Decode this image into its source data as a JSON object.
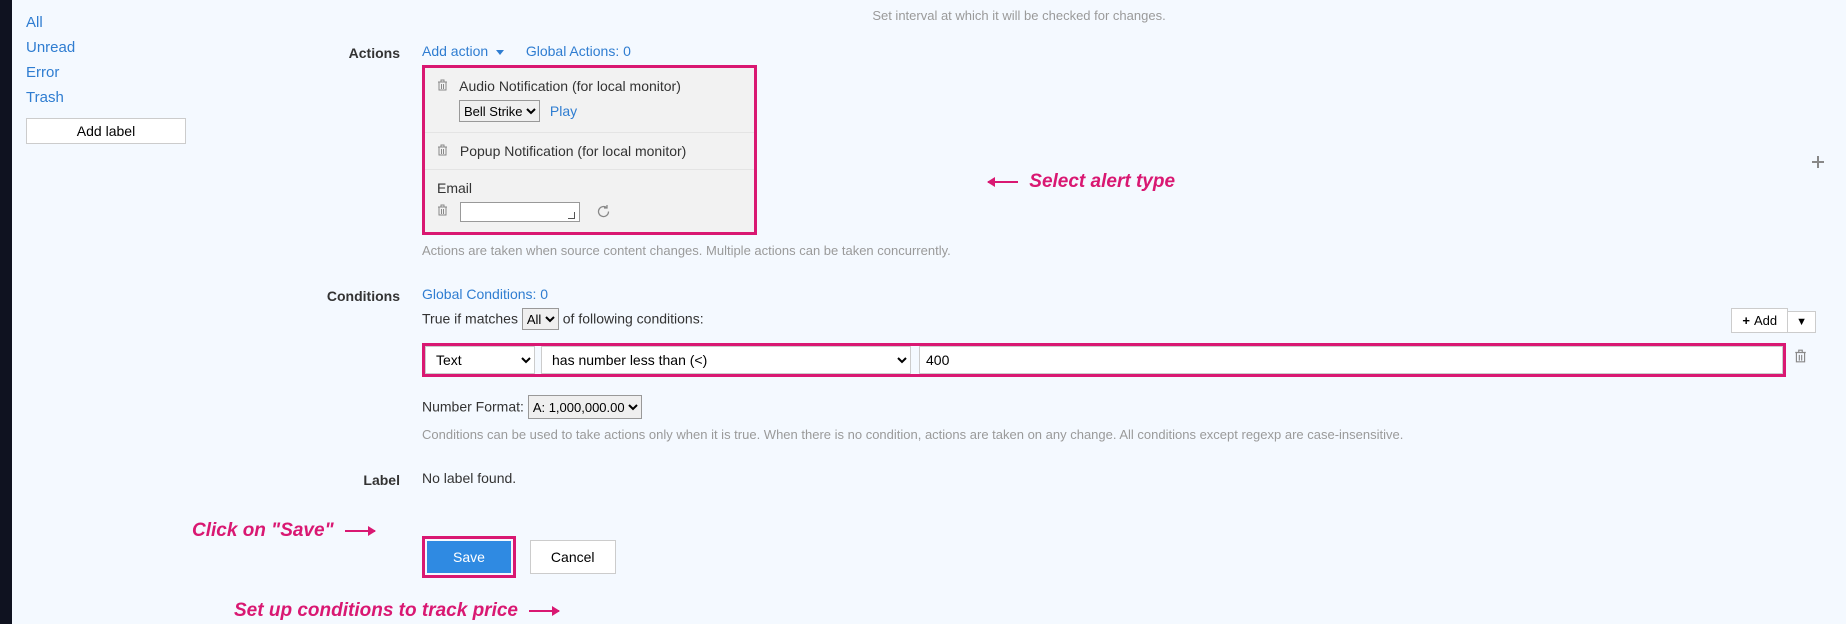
{
  "sidebar": {
    "items": [
      {
        "label": "All"
      },
      {
        "label": "Unread"
      },
      {
        "label": "Error"
      },
      {
        "label": "Trash"
      }
    ],
    "add_label": "Add label"
  },
  "interval_hint": "Set interval at which it will be checked for changes.",
  "sections": {
    "actions": {
      "title": "Actions",
      "add_action": "Add action",
      "global_link": "Global Actions: 0",
      "audio_label": "Audio Notification (for local monitor)",
      "audio_selected": "Bell Strike",
      "play": "Play",
      "popup_label": "Popup Notification (for local monitor)",
      "email_label": "Email",
      "help": "Actions are taken when source content changes. Multiple actions can be taken concurrently."
    },
    "conditions": {
      "title": "Conditions",
      "global_link": "Global Conditions: 0",
      "match_prefix": "True if matches",
      "match_mode": "All",
      "match_suffix": "of following conditions:",
      "add_btn": "Add",
      "row": {
        "type": "Text",
        "op": "has number less than (<)",
        "value": "400"
      },
      "numfmt_label": "Number Format:",
      "numfmt_value": "A: 1,000,000.00",
      "help": "Conditions can be used to take actions only when it is true. When there is no condition, actions are taken on any change. All conditions except regexp are case-insensitive."
    },
    "label": {
      "title": "Label",
      "none": "No label found."
    }
  },
  "buttons": {
    "save": "Save",
    "cancel": "Cancel"
  },
  "annotations": {
    "alert": "Select alert type",
    "cond": "Set up conditions to track price",
    "save": "Click on \"Save\""
  }
}
